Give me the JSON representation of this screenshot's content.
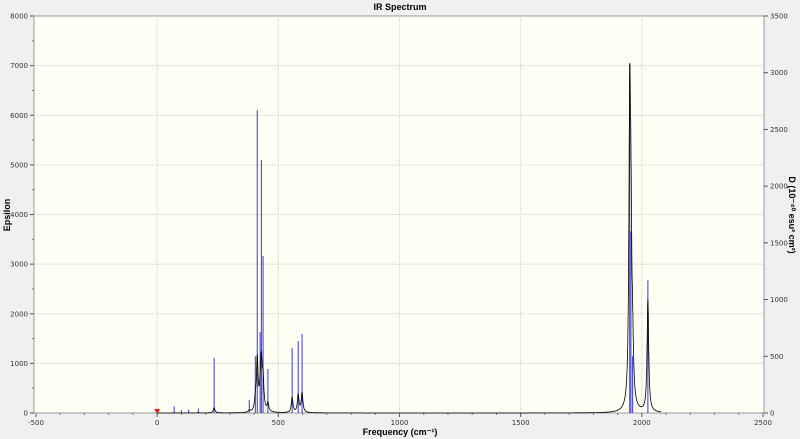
{
  "chart_data": {
    "type": "line",
    "title": "IR Spectrum",
    "xlabel": "Frequency (cm⁻¹)",
    "ylabel": "Epsilon",
    "y2label": "D (10⁻⁴⁰ esu² cm²)",
    "xlim": [
      -500,
      2500
    ],
    "ylim": [
      0,
      8000
    ],
    "y2lim": [
      0,
      3500
    ],
    "xticks": [
      -500,
      0,
      500,
      1000,
      1500,
      2000,
      2500
    ],
    "yticks": [
      0,
      1000,
      2000,
      3000,
      4000,
      5000,
      6000,
      7000,
      8000
    ],
    "y2ticks": [
      0,
      500,
      1000,
      1500,
      2000,
      2500,
      3000,
      3500
    ],
    "grid": true,
    "colors": {
      "spectrum": "#000000",
      "sticks": "#3a3ad0",
      "plot_bg": "#fffff6",
      "marker": "#e02020"
    },
    "series": [
      {
        "kind": "sticks",
        "axis": "y2",
        "x": [
          70,
          100,
          130,
          170,
          235,
          380,
          405,
          413,
          425,
          430,
          437,
          457,
          557,
          582,
          598,
          1950,
          1955,
          1962,
          2025
        ],
        "values": [
          60,
          25,
          30,
          40,
          485,
          115,
          500,
          2670,
          714,
          2230,
          1384,
          388,
          573,
          635,
          697,
          3080,
          1600,
          500,
          1170
        ]
      },
      {
        "kind": "spectrum",
        "axis": "y",
        "peak_value": 7050
      }
    ],
    "marker_x": 0
  }
}
